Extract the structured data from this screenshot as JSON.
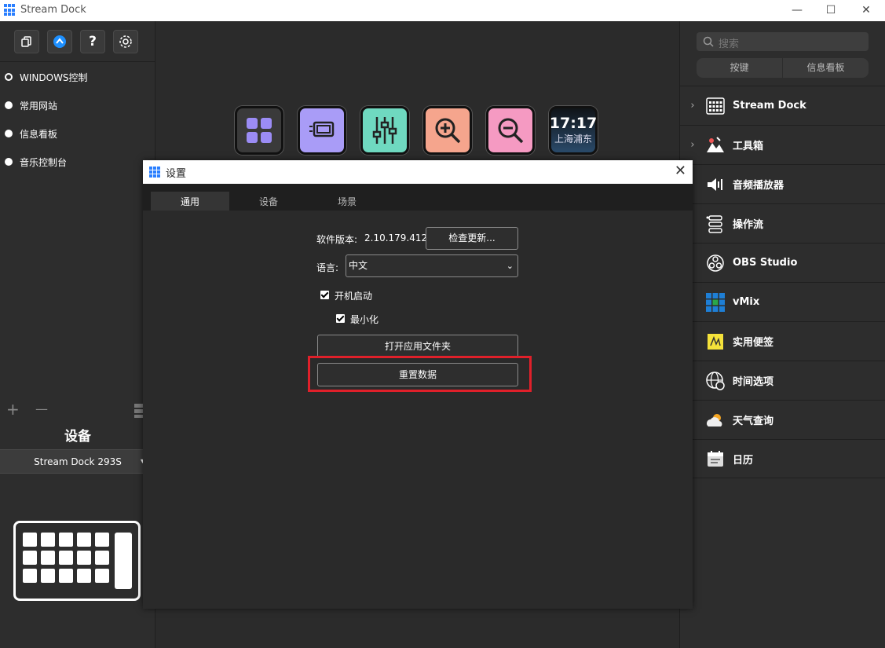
{
  "window": {
    "title": "Stream Dock",
    "minimize": "—",
    "maximize": "☐",
    "close": "✕"
  },
  "left": {
    "profiles": [
      {
        "label": "WINDOWS控制",
        "selected": true
      },
      {
        "label": "常用网站",
        "selected": false
      },
      {
        "label": "信息看板",
        "selected": false
      },
      {
        "label": "音乐控制台",
        "selected": false
      }
    ],
    "add": "+",
    "remove": "—",
    "device_title": "设备",
    "device_name": "Stream Dock 293S"
  },
  "center": {
    "keys": [
      {
        "icon": "grid-icon",
        "color": "#9b8cf5"
      },
      {
        "icon": "screen-icon",
        "color": "#a99cf7"
      },
      {
        "icon": "mixer-icon",
        "color": "#6fd9c0"
      },
      {
        "icon": "zoom-in-icon",
        "color": "#f5a58d"
      },
      {
        "icon": "zoom-out-icon",
        "color": "#f59ac2"
      },
      {
        "icon": "clock-icon",
        "time": "17:17",
        "location": "上海浦东"
      }
    ]
  },
  "right": {
    "search_placeholder": "搜索",
    "tabs": [
      "按键",
      "信息看板"
    ],
    "plugins": [
      {
        "name": "Stream Dock",
        "icon": "keypad-icon",
        "expandable": true
      },
      {
        "name": "工具箱",
        "icon": "toolbox-icon",
        "expandable": true
      },
      {
        "name": "音频播放器",
        "icon": "speaker-icon",
        "expandable": false
      },
      {
        "name": "操作流",
        "icon": "workflow-icon",
        "expandable": false
      },
      {
        "name": "OBS Studio",
        "icon": "obs-icon",
        "expandable": false
      },
      {
        "name": "vMix",
        "icon": "vmix-icon",
        "expandable": false
      },
      {
        "name": "实用便签",
        "icon": "note-icon",
        "expandable": false
      },
      {
        "name": "时间选项",
        "icon": "globe-clock-icon",
        "expandable": false
      },
      {
        "name": "天气查询",
        "icon": "weather-icon",
        "expandable": false
      },
      {
        "name": "日历",
        "icon": "calendar-icon",
        "expandable": false
      }
    ]
  },
  "dialog": {
    "title": "设置",
    "close": "✕",
    "tabs": [
      {
        "label": "通用",
        "active": true
      },
      {
        "label": "设备",
        "active": false
      },
      {
        "label": "场景",
        "active": false
      }
    ],
    "version_label": "软件版本:",
    "version_value": "2.10.179.412",
    "check_update": "检查更新...",
    "language_label": "语言:",
    "language_value": "中文",
    "autostart_label": "开机启动",
    "autostart_checked": true,
    "minimize_label": "最小化",
    "minimize_checked": true,
    "open_folder": "打开应用文件夹",
    "reset_data": "重置数据",
    "highlight_color": "#e0202a"
  }
}
